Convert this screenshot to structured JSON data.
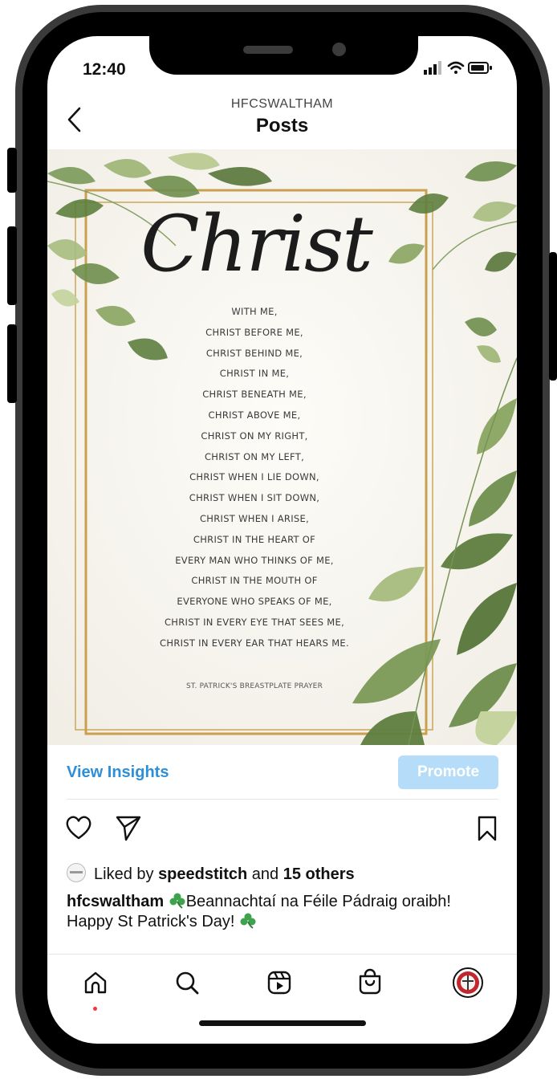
{
  "status_bar": {
    "time": "12:40"
  },
  "header": {
    "account": "HFCSWALTHAM",
    "title": "Posts"
  },
  "post": {
    "headline": "Christ",
    "poem_lines": [
      "WITH ME,",
      "CHRIST BEFORE ME,",
      "CHRIST BEHIND ME,",
      "CHRIST IN ME,",
      "CHRIST BENEATH ME,",
      "CHRIST ABOVE ME,",
      "CHRIST ON MY RIGHT,",
      "CHRIST ON MY LEFT,",
      "CHRIST WHEN I LIE DOWN,",
      "CHRIST WHEN I SIT DOWN,",
      "CHRIST WHEN I ARISE,",
      "CHRIST IN THE HEART OF",
      "EVERY MAN WHO THINKS OF ME,",
      "CHRIST IN THE MOUTH OF",
      "EVERYONE WHO SPEAKS OF ME,",
      "CHRIST IN EVERY EYE THAT SEES ME,",
      "CHRIST IN EVERY EAR THAT HEARS ME."
    ],
    "attribution": "ST. PATRICK'S BREASTPLATE PRAYER"
  },
  "actions": {
    "view_insights": "View Insights",
    "promote": "Promote"
  },
  "likes": {
    "prefix": "Liked by ",
    "user": "speedstitch",
    "middle": " and ",
    "others": "15 others"
  },
  "caption": {
    "username": "hfcswaltham",
    "text_line1": "Beannachtaí na Féile Pádraig oraibh!",
    "text_line2": "Happy St Patrick's Day!"
  },
  "colors": {
    "link_blue": "#2e8fd9",
    "promote_bg": "#b5dcf8",
    "gold": "#c9a04f",
    "leaf_green": "#6f8f4e"
  }
}
